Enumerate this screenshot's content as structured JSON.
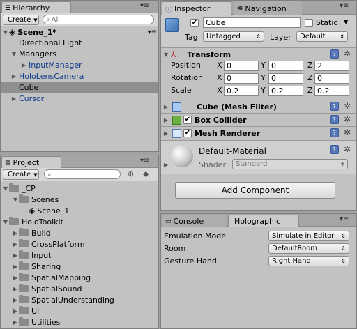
{
  "hierarchy": {
    "tab_label": "Hierarchy",
    "create_label": "Create",
    "search_placeholder": "All",
    "scene_label": "Scene_1*",
    "items": [
      {
        "label": "Directional Light",
        "prefab": false
      },
      {
        "label": "Managers",
        "prefab": false
      },
      {
        "label": "InputManager",
        "prefab": true
      },
      {
        "label": "HoloLensCamera",
        "prefab": true
      },
      {
        "label": "Cube",
        "prefab": false
      },
      {
        "label": "Cursor",
        "prefab": true
      }
    ]
  },
  "project": {
    "tab_label": "Project",
    "create_label": "Create",
    "items": [
      {
        "label": "_CP"
      },
      {
        "label": "Scenes"
      },
      {
        "label": "Scene_1"
      },
      {
        "label": "HoloToolkit"
      },
      {
        "label": "Build"
      },
      {
        "label": "CrossPlatform"
      },
      {
        "label": "Input"
      },
      {
        "label": "Sharing"
      },
      {
        "label": "SpatialMapping"
      },
      {
        "label": "SpatialSound"
      },
      {
        "label": "SpatialUnderstanding"
      },
      {
        "label": "UI"
      },
      {
        "label": "Utilities"
      }
    ]
  },
  "inspector": {
    "tab_label": "Inspector",
    "nav_tab_label": "Navigation",
    "object_name": "Cube",
    "static_label": "Static",
    "tag_label": "Tag",
    "tag_value": "Untagged",
    "layer_label": "Layer",
    "layer_value": "Default",
    "transform": {
      "title": "Transform",
      "position_label": "Position",
      "rotation_label": "Rotation",
      "scale_label": "Scale",
      "x": "X",
      "y": "Y",
      "z": "Z",
      "position": [
        "0",
        "0",
        "2"
      ],
      "rotation": [
        "0",
        "0",
        "0"
      ],
      "scale": [
        "0.2",
        "0.2",
        "0.2"
      ]
    },
    "mesh_filter_title": "Cube (Mesh Filter)",
    "box_collider_title": "Box Collider",
    "mesh_renderer_title": "Mesh Renderer",
    "material": {
      "name": "Default-Material",
      "shader_label": "Shader",
      "shader_value": "Standard"
    },
    "add_component_label": "Add Component"
  },
  "console": {
    "console_tab_label": "Console",
    "holographic_tab_label": "Holographic",
    "emulation_mode_label": "Emulation Mode",
    "emulation_mode_value": "Simulate in Editor",
    "room_label": "Room",
    "room_value": "DefaultRoom",
    "gesture_hand_label": "Gesture Hand",
    "gesture_hand_value": "Right Hand"
  }
}
